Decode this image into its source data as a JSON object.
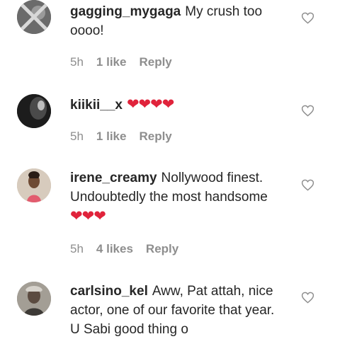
{
  "comments": [
    {
      "username": "gagging_mygaga",
      "text": "My crush too oooo!",
      "hearts": "",
      "time": "5h",
      "likes": "1 like",
      "reply": "Reply",
      "avatar_icon": "avatar-blocked"
    },
    {
      "username": "kiikii__x",
      "text": "",
      "hearts": "❤❤❤❤",
      "time": "5h",
      "likes": "1 like",
      "reply": "Reply",
      "avatar_icon": "avatar-dark"
    },
    {
      "username": "irene_creamy",
      "text": "Nollywood finest. Undoubtedly the most handsome",
      "hearts": "❤❤❤",
      "time": "5h",
      "likes": "4 likes",
      "reply": "Reply",
      "avatar_icon": "avatar-woman"
    },
    {
      "username": "carlsino_kel",
      "text": "Aww, Pat attah, nice actor, one of our favorite that year. U Sabi good thing o",
      "hearts": "",
      "time": "",
      "likes": "",
      "reply": "",
      "avatar_icon": "avatar-man"
    }
  ],
  "colors": {
    "heart": "#e0233b",
    "meta": "#8e8e8e",
    "text": "#262626"
  }
}
